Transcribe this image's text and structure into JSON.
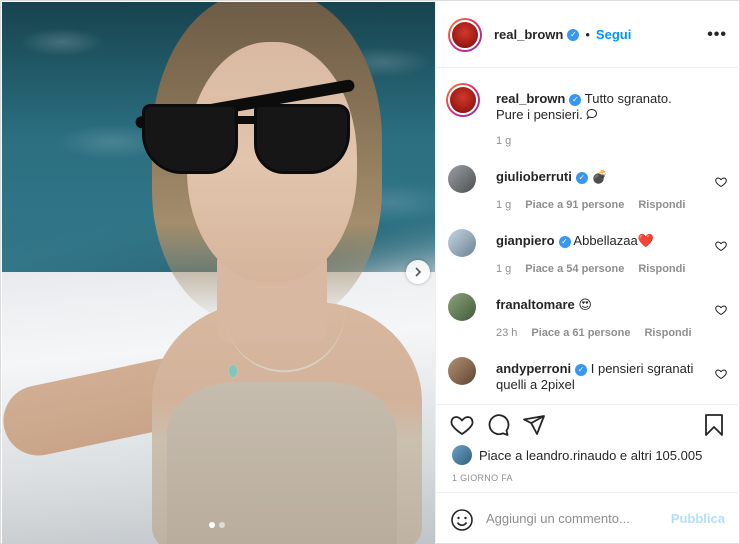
{
  "post": {
    "username": "real_brown",
    "follow_label": "Segui",
    "separator": "•",
    "more_icon": "more-icon",
    "caption_line1": "Tutto sgranato.",
    "caption_line2": "Pure i pensieri.",
    "caption_time": "1 g"
  },
  "comments": [
    {
      "user": "giulioberruti",
      "text": "💣",
      "time": "1 g",
      "likes": "Piace a 91 persone",
      "reply": "Rispondi"
    },
    {
      "user": "gianpiero",
      "text": "Abbellazaa❤️",
      "time": "1 g",
      "likes": "Piace a 54 persone",
      "reply": "Rispondi"
    },
    {
      "user": "franaltomare",
      "text": "😍",
      "time": "23 h",
      "likes": "Piace a 61 persone",
      "reply": "Rispondi"
    },
    {
      "user": "andyperroni",
      "text": "I pensieri sgranati",
      "text2": "quelli a 2pixel"
    }
  ],
  "likes_text": "Piace a leandro.rinaudo e altri 105.005",
  "date_text": "1 GIORNO FA",
  "composer": {
    "placeholder": "Aggiungi un commento...",
    "publish_label": "Pubblica"
  },
  "colors": {
    "link_blue": "#0095f6",
    "verified_blue": "#3897f0",
    "muted": "#8e8e8e"
  }
}
